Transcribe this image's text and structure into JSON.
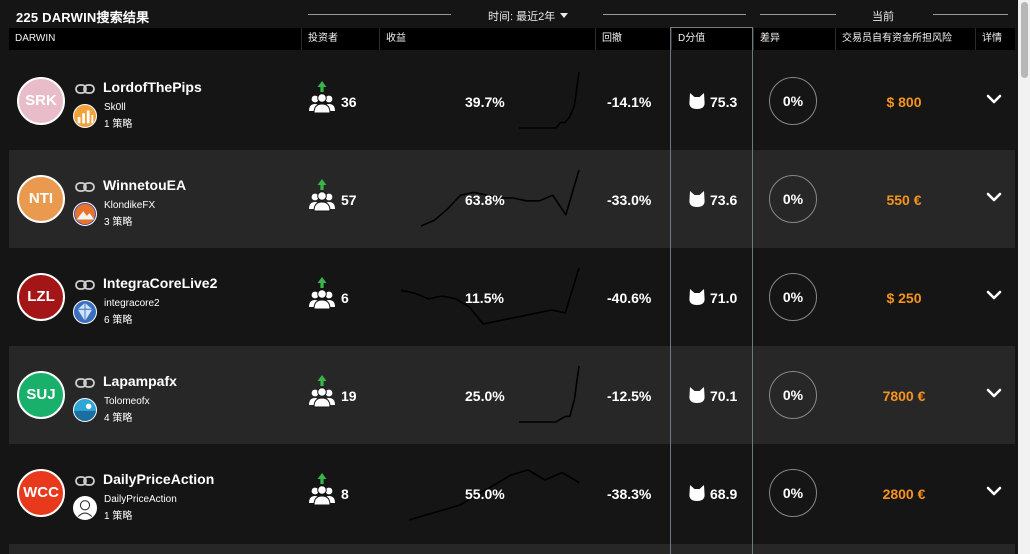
{
  "header": {
    "title": "225 DARWIN搜索结果",
    "period_label": "时间: 最近2年",
    "current_label": "当前"
  },
  "columns": {
    "darwin": "DARWIN",
    "investors": "投资者",
    "returns": "收益",
    "drawdown": "回撤",
    "dscore": "D分值",
    "divergence": "差异",
    "trader_capital": "交易员自有资金所担风险",
    "details": "详情"
  },
  "colors": {
    "accent": "#f7941d",
    "trend_up": "#39b54a",
    "bg": "#151515",
    "row_alt": "#272727"
  },
  "icons": {
    "link": "link-icon",
    "investors": "investors-icon",
    "dscore": "cat-head-icon",
    "expand": "chevron-down-icon"
  },
  "rows": [
    {
      "code": "SRK",
      "avatar_color": "#e8bcc8",
      "name": "LordofThePips",
      "trader": "Sk0ll",
      "strategies": "1 策略",
      "trader_avatar": {
        "bg": "#f3a23b",
        "kind": "bars"
      },
      "investors": "36",
      "return": "39.7%",
      "drawdown": "-14.1%",
      "dscore": "75.3",
      "divergence": "0%",
      "capital": "$ 800",
      "spark": [
        0,
        0,
        0,
        0,
        0,
        0,
        0,
        0,
        0,
        0.1,
        0.1,
        0.2,
        0.4,
        1.0
      ]
    },
    {
      "code": "NTI",
      "avatar_color": "#e99a4f",
      "name": "WinnetouEA",
      "trader": "KlondikeFX",
      "strategies": "3 策略",
      "trader_avatar": {
        "bg": "#3f4fa8",
        "kind": "mountain"
      },
      "investors": "57",
      "return": "63.8%",
      "drawdown": "-33.0%",
      "dscore": "73.6",
      "divergence": "0%",
      "capital": "550 €",
      "spark": [
        0.0,
        0.1,
        0.3,
        0.55,
        0.6,
        0.55,
        0.5,
        0.5,
        0.45,
        0.45,
        0.55,
        0.2,
        1.0
      ]
    },
    {
      "code": "LZL",
      "avatar_color": "#a31517",
      "name": "IntegraCoreLive2",
      "trader": "integracore2",
      "strategies": "6 策略",
      "trader_avatar": {
        "bg": "#3a6fbf",
        "kind": "crystal"
      },
      "investors": "6",
      "return": "11.5%",
      "drawdown": "-40.6%",
      "dscore": "71.0",
      "divergence": "0%",
      "capital": "$ 250",
      "spark": [
        0.6,
        0.55,
        0.45,
        0.5,
        0.45,
        0.3,
        0.0,
        0.05,
        0.1,
        0.15,
        0.2,
        0.25,
        0.2,
        1.0
      ]
    },
    {
      "code": "SUJ",
      "avatar_color": "#19b06b",
      "name": "Lapampafx",
      "trader": "Tolomeofx",
      "strategies": "4 策略",
      "trader_avatar": {
        "bg": "#2ea6d8",
        "kind": "sea"
      },
      "investors": "19",
      "return": "25.0%",
      "drawdown": "-12.5%",
      "dscore": "70.1",
      "divergence": "0%",
      "capital": "7800 €",
      "spark": [
        0,
        0,
        0,
        0,
        0,
        0,
        0,
        0,
        0,
        0.05,
        0.1,
        0.1,
        0.4,
        1.0
      ]
    },
    {
      "code": "WCC",
      "avatar_color": "#e8391c",
      "name": "DailyPriceAction",
      "trader": "DailyPriceAction",
      "strategies": "1 策略",
      "trader_avatar": {
        "bg": "#ffffff",
        "kind": "portrait"
      },
      "investors": "8",
      "return": "55.0%",
      "drawdown": "-38.3%",
      "dscore": "68.9",
      "divergence": "0%",
      "capital": "2800 €",
      "spark": [
        0.0,
        0.1,
        0.2,
        0.3,
        0.5,
        0.7,
        0.9,
        1.0,
        0.8,
        0.95,
        0.75
      ]
    }
  ]
}
